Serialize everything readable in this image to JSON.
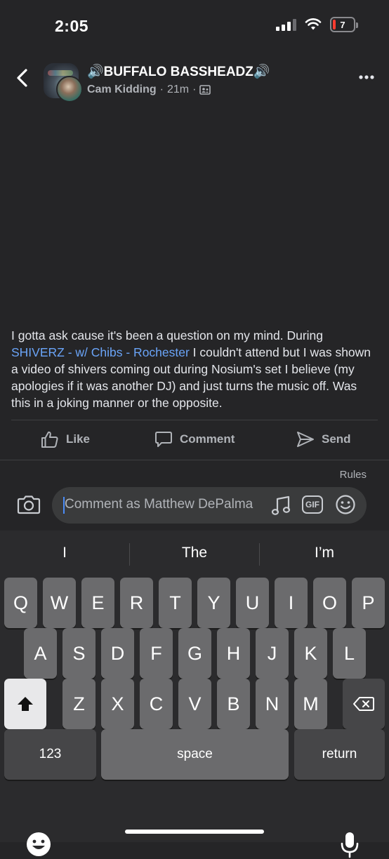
{
  "status_bar": {
    "time": "2:05",
    "battery": "7"
  },
  "header": {
    "group_name": "🔊BUFFALO BASSHEADZ🔊",
    "author": "Cam Kidding",
    "time_ago": "21m",
    "separator": "·"
  },
  "post": {
    "text_before": "I gotta ask cause it's been a question on my mind. During ",
    "link": "SHIVERZ - w/ Chibs - Rochester",
    "text_after": "  I couldn't attend but I was shown a video of shivers coming out during Nosium's set I believe (my apologies if it was another DJ) and just turns the music off. Was this in a joking manner or the opposite."
  },
  "actions": {
    "like": "Like",
    "comment": "Comment",
    "send": "Send"
  },
  "comment_bar": {
    "rules": "Rules",
    "placeholder": "Comment as Matthew DePalma",
    "gif": "GIF"
  },
  "keyboard": {
    "suggestions": [
      "I",
      "The",
      "I’m"
    ],
    "row1": [
      "Q",
      "W",
      "E",
      "R",
      "T",
      "Y",
      "U",
      "I",
      "O",
      "P"
    ],
    "row2": [
      "A",
      "S",
      "D",
      "F",
      "G",
      "H",
      "J",
      "K",
      "L"
    ],
    "row3": [
      "Z",
      "X",
      "C",
      "V",
      "B",
      "N",
      "M"
    ],
    "numbers": "123",
    "space": "space",
    "return": "return"
  },
  "colors": {
    "link": "#6aa4f8",
    "background": "#252527",
    "keyboard": "#2b2b2d"
  }
}
